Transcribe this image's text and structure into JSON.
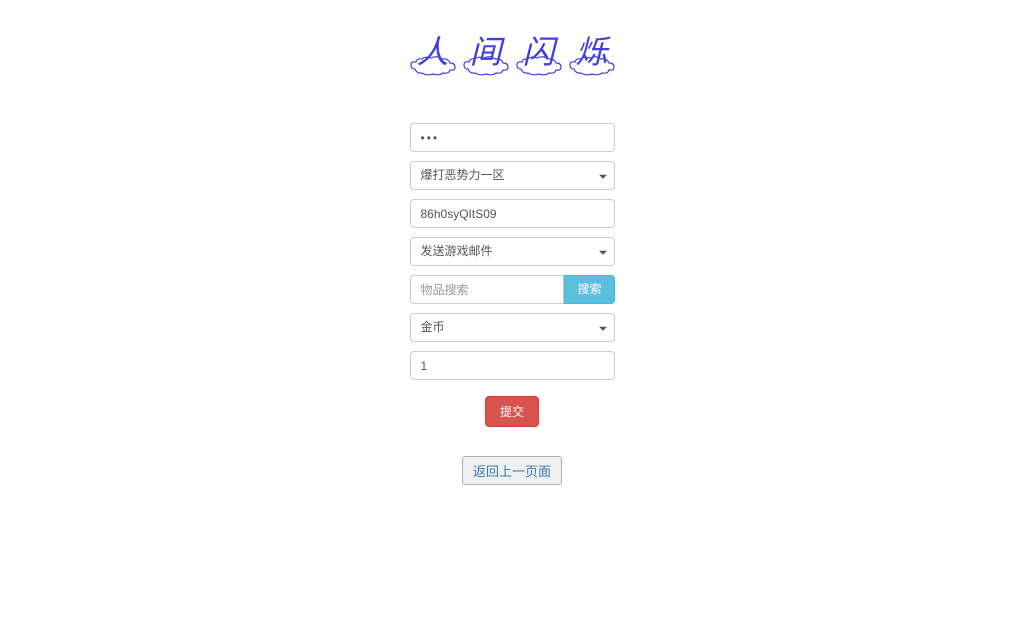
{
  "logo": {
    "chars": [
      "人",
      "间",
      "闪",
      "烁"
    ]
  },
  "form": {
    "password_value": "•••",
    "server_select": "爆打恶势力一区",
    "code_value": "86h0syQItS09",
    "action_select": "发送游戏邮件",
    "search_placeholder": "物品搜索",
    "search_button": "搜索",
    "item_select": "金币",
    "quantity_value": "1",
    "submit_label": "提交",
    "back_label": "返回上一页面"
  }
}
